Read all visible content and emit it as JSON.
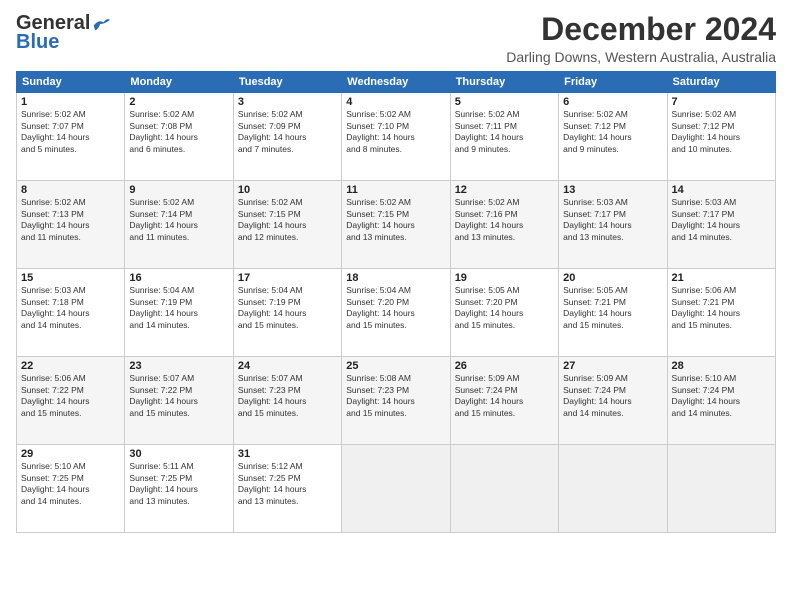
{
  "header": {
    "logo_general": "General",
    "logo_blue": "Blue",
    "month_title": "December 2024",
    "location": "Darling Downs, Western Australia, Australia"
  },
  "days_of_week": [
    "Sunday",
    "Monday",
    "Tuesday",
    "Wednesday",
    "Thursday",
    "Friday",
    "Saturday"
  ],
  "weeks": [
    [
      {
        "day": 1,
        "rise": "5:02 AM",
        "set": "7:07 PM",
        "dl": "14 hours and 5 minutes."
      },
      {
        "day": 2,
        "rise": "5:02 AM",
        "set": "7:08 PM",
        "dl": "14 hours and 6 minutes."
      },
      {
        "day": 3,
        "rise": "5:02 AM",
        "set": "7:09 PM",
        "dl": "14 hours and 7 minutes."
      },
      {
        "day": 4,
        "rise": "5:02 AM",
        "set": "7:10 PM",
        "dl": "14 hours and 8 minutes."
      },
      {
        "day": 5,
        "rise": "5:02 AM",
        "set": "7:11 PM",
        "dl": "14 hours and 9 minutes."
      },
      {
        "day": 6,
        "rise": "5:02 AM",
        "set": "7:12 PM",
        "dl": "14 hours and 9 minutes."
      },
      {
        "day": 7,
        "rise": "5:02 AM",
        "set": "7:12 PM",
        "dl": "14 hours and 10 minutes."
      }
    ],
    [
      {
        "day": 8,
        "rise": "5:02 AM",
        "set": "7:13 PM",
        "dl": "14 hours and 11 minutes."
      },
      {
        "day": 9,
        "rise": "5:02 AM",
        "set": "7:14 PM",
        "dl": "14 hours and 11 minutes."
      },
      {
        "day": 10,
        "rise": "5:02 AM",
        "set": "7:15 PM",
        "dl": "14 hours and 12 minutes."
      },
      {
        "day": 11,
        "rise": "5:02 AM",
        "set": "7:15 PM",
        "dl": "14 hours and 13 minutes."
      },
      {
        "day": 12,
        "rise": "5:02 AM",
        "set": "7:16 PM",
        "dl": "14 hours and 13 minutes."
      },
      {
        "day": 13,
        "rise": "5:03 AM",
        "set": "7:17 PM",
        "dl": "14 hours and 13 minutes."
      },
      {
        "day": 14,
        "rise": "5:03 AM",
        "set": "7:17 PM",
        "dl": "14 hours and 14 minutes."
      }
    ],
    [
      {
        "day": 15,
        "rise": "5:03 AM",
        "set": "7:18 PM",
        "dl": "14 hours and 14 minutes."
      },
      {
        "day": 16,
        "rise": "5:04 AM",
        "set": "7:19 PM",
        "dl": "14 hours and 14 minutes."
      },
      {
        "day": 17,
        "rise": "5:04 AM",
        "set": "7:19 PM",
        "dl": "14 hours and 15 minutes."
      },
      {
        "day": 18,
        "rise": "5:04 AM",
        "set": "7:20 PM",
        "dl": "14 hours and 15 minutes."
      },
      {
        "day": 19,
        "rise": "5:05 AM",
        "set": "7:20 PM",
        "dl": "14 hours and 15 minutes."
      },
      {
        "day": 20,
        "rise": "5:05 AM",
        "set": "7:21 PM",
        "dl": "14 hours and 15 minutes."
      },
      {
        "day": 21,
        "rise": "5:06 AM",
        "set": "7:21 PM",
        "dl": "14 hours and 15 minutes."
      }
    ],
    [
      {
        "day": 22,
        "rise": "5:06 AM",
        "set": "7:22 PM",
        "dl": "14 hours and 15 minutes."
      },
      {
        "day": 23,
        "rise": "5:07 AM",
        "set": "7:22 PM",
        "dl": "14 hours and 15 minutes."
      },
      {
        "day": 24,
        "rise": "5:07 AM",
        "set": "7:23 PM",
        "dl": "14 hours and 15 minutes."
      },
      {
        "day": 25,
        "rise": "5:08 AM",
        "set": "7:23 PM",
        "dl": "14 hours and 15 minutes."
      },
      {
        "day": 26,
        "rise": "5:09 AM",
        "set": "7:24 PM",
        "dl": "14 hours and 15 minutes."
      },
      {
        "day": 27,
        "rise": "5:09 AM",
        "set": "7:24 PM",
        "dl": "14 hours and 14 minutes."
      },
      {
        "day": 28,
        "rise": "5:10 AM",
        "set": "7:24 PM",
        "dl": "14 hours and 14 minutes."
      }
    ],
    [
      {
        "day": 29,
        "rise": "5:10 AM",
        "set": "7:25 PM",
        "dl": "14 hours and 14 minutes."
      },
      {
        "day": 30,
        "rise": "5:11 AM",
        "set": "7:25 PM",
        "dl": "14 hours and 13 minutes."
      },
      {
        "day": 31,
        "rise": "5:12 AM",
        "set": "7:25 PM",
        "dl": "14 hours and 13 minutes."
      },
      null,
      null,
      null,
      null
    ]
  ],
  "labels": {
    "sunrise": "Sunrise:",
    "sunset": "Sunset:",
    "daylight": "Daylight:"
  }
}
